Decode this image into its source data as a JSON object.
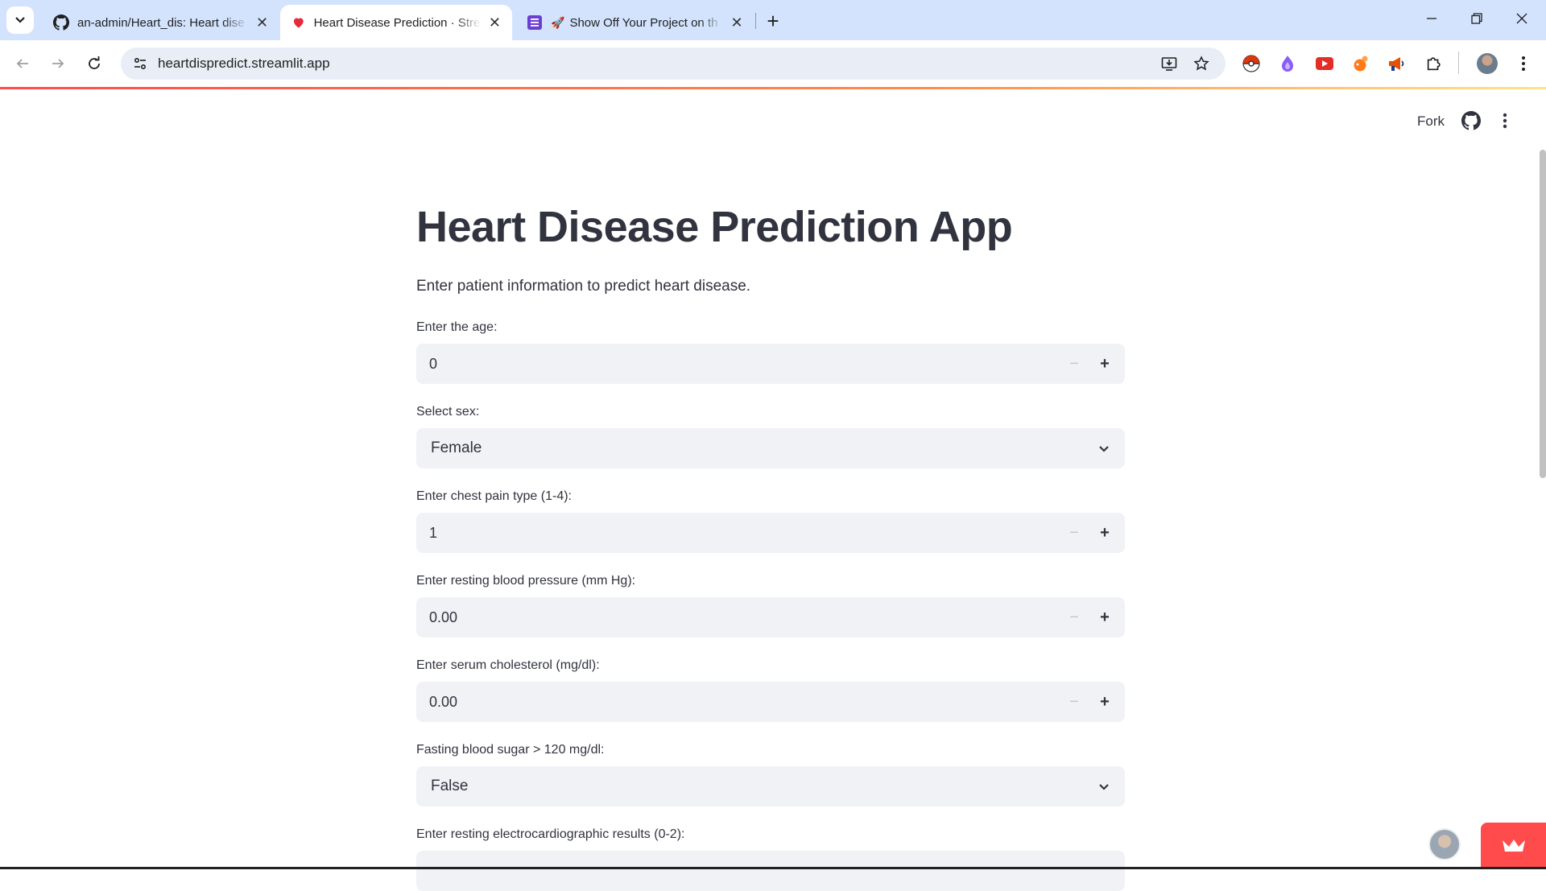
{
  "browser": {
    "tabs": [
      {
        "title": "an-admin/Heart_dis: Heart dise",
        "icon": "github-icon"
      },
      {
        "title": "Heart Disease Prediction · Strea",
        "icon": "heart-icon"
      },
      {
        "title": "Show Off Your Project on th",
        "icon": "forum-icon"
      }
    ],
    "url": "heartdispredict.streamlit.app"
  },
  "app_header": {
    "fork_label": "Fork"
  },
  "main": {
    "title": "Heart Disease Prediction App",
    "subtitle": "Enter patient information to predict heart disease.",
    "fields": [
      {
        "label": "Enter the age:",
        "type": "number",
        "value": "0"
      },
      {
        "label": "Select sex:",
        "type": "select",
        "value": "Female"
      },
      {
        "label": "Enter chest pain type (1-4):",
        "type": "number",
        "value": "1"
      },
      {
        "label": "Enter resting blood pressure (mm Hg):",
        "type": "number",
        "value": "0.00"
      },
      {
        "label": "Enter serum cholesterol (mg/dl):",
        "type": "number",
        "value": "0.00"
      },
      {
        "label": "Fasting blood sugar > 120 mg/dl:",
        "type": "select",
        "value": "False"
      },
      {
        "label": "Enter resting electrocardiographic results (0-2):",
        "type": "number",
        "value": ""
      }
    ]
  },
  "colors": {
    "accent": "#ff4b4b",
    "input_bg": "#f0f2f6",
    "text": "#31333f",
    "tabstrip": "#d3e3fd"
  }
}
